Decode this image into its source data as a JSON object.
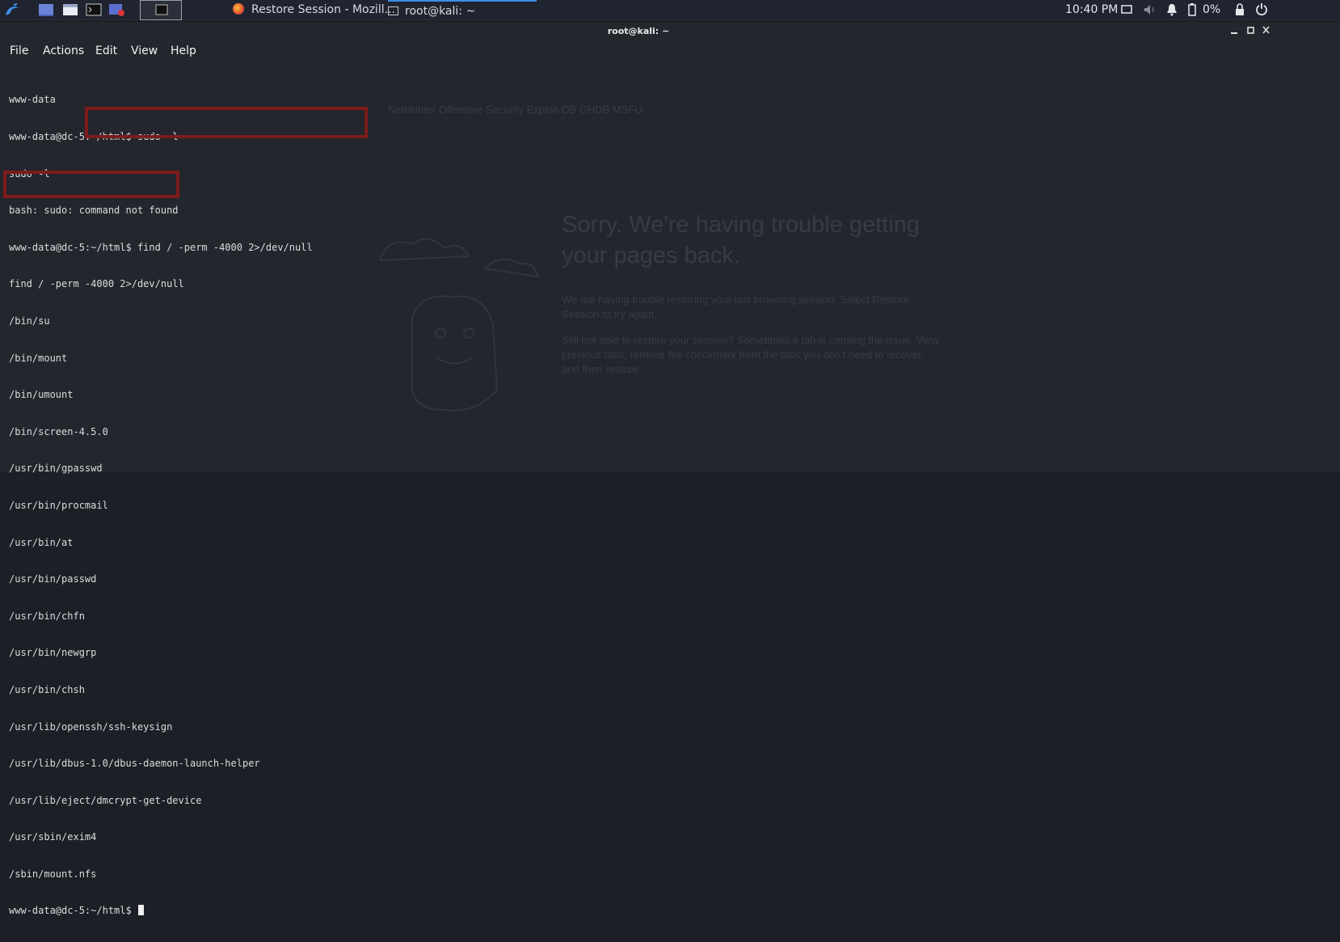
{
  "taskbar": {
    "tasks": [
      {
        "label": "Restore Session - Mozill...",
        "icon": "firefox-icon"
      },
      {
        "label": "root@kali: ~",
        "icon": "terminal-icon"
      }
    ],
    "clock": "10:40 PM",
    "battery": "0%"
  },
  "terminal": {
    "title": "root@kali: ~",
    "menu": [
      "File",
      "Actions",
      "Edit",
      "View",
      "Help"
    ],
    "lines": [
      "www-data",
      "www-data@dc-5:~/html$ sudo -l",
      "sudo -l",
      "bash: sudo: command not found",
      "www-data@dc-5:~/html$ find / -perm -4000 2>/dev/null",
      "find / -perm -4000 2>/dev/null",
      "/bin/su",
      "/bin/mount",
      "/bin/umount",
      "/bin/screen-4.5.0",
      "/usr/bin/gpasswd",
      "/usr/bin/procmail",
      "/usr/bin/at",
      "/usr/bin/passwd",
      "/usr/bin/chfn",
      "/usr/bin/newgrp",
      "/usr/bin/chsh",
      "/usr/lib/openssh/ssh-keysign",
      "/usr/lib/dbus-1.0/dbus-daemon-launch-helper",
      "/usr/lib/eject/dmcrypt-get-device",
      "/usr/sbin/exim4",
      "/sbin/mount.nfs"
    ],
    "prompt": "www-data@dc-5:~/html$ "
  },
  "background_browser": {
    "bookmarks": "NetHunter   Offensive Security   Exploit-DB   GHDB   MSFU",
    "heading": "Sorry. We're having trouble getting your pages back.",
    "para1": "We are having trouble restoring your last browsing session. Select Restore Session to try again.",
    "para2": "Still not able to restore your session? Sometimes a tab is causing the issue. View previous tabs, remove the checkmark from the tabs you don't need to recover, and then restore."
  },
  "colors": {
    "highlight_box": "#7e1b1b",
    "terminal_bg": "#23262d",
    "taskbar_bg": "#1f2430"
  }
}
